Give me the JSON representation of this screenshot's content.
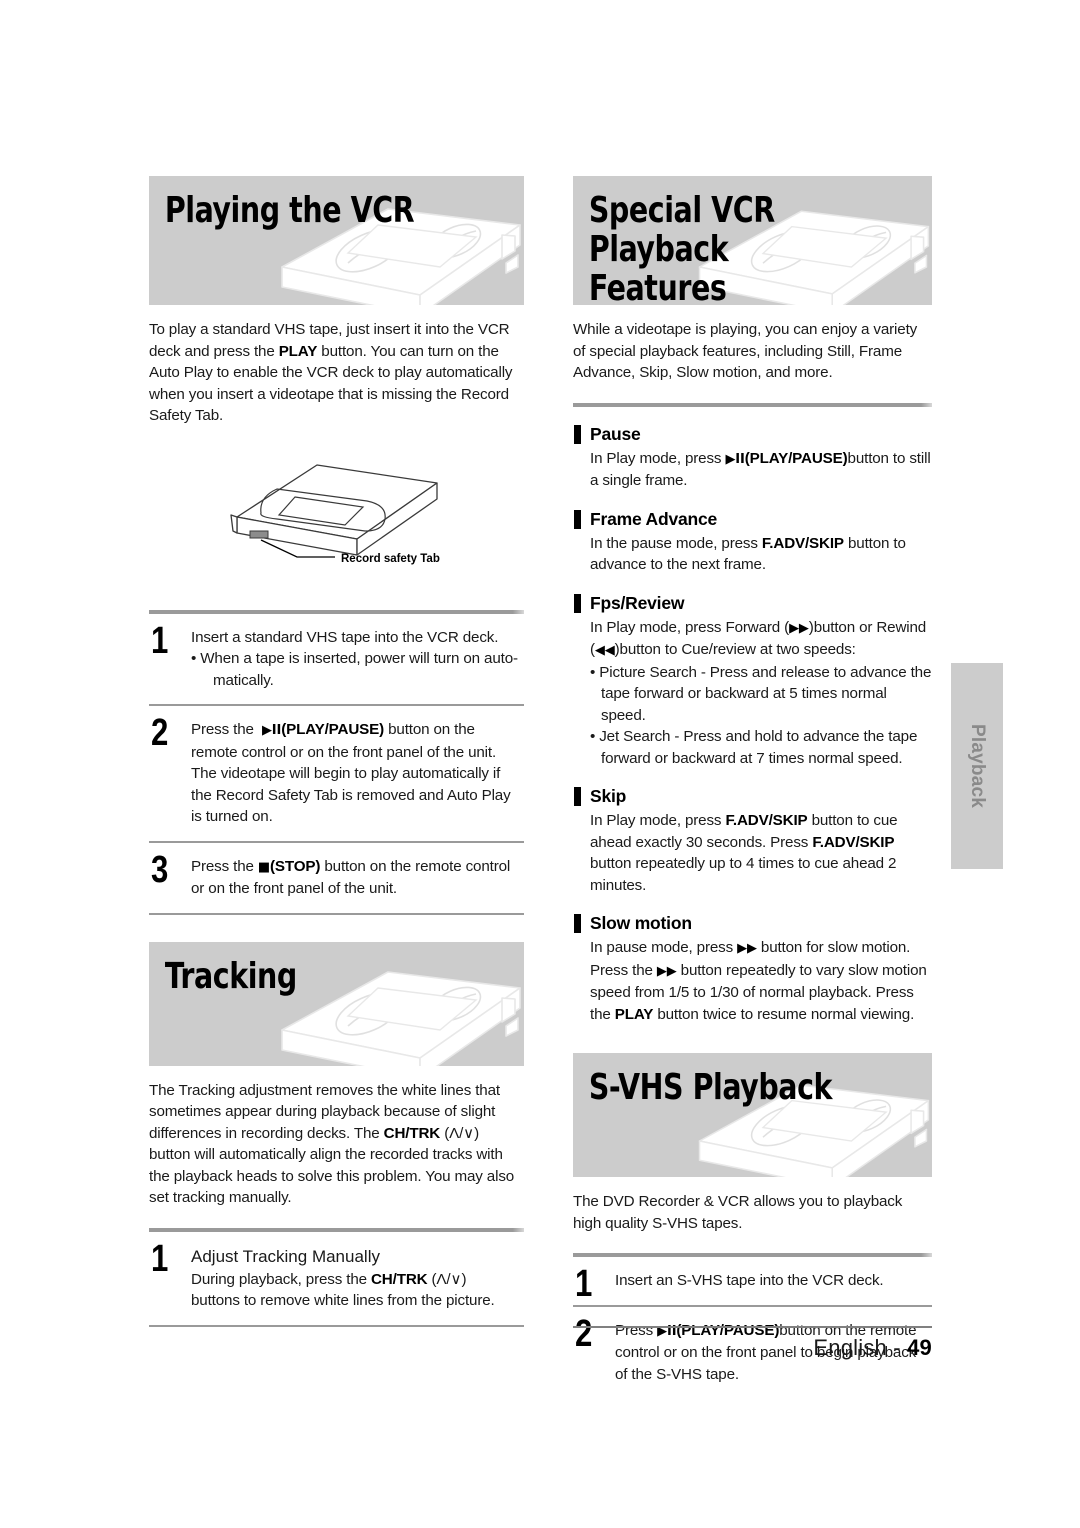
{
  "document": {
    "language_footer": "English - ",
    "page_number": "49",
    "side_tab_label": "Playback",
    "banner_bg": "#cccccc"
  },
  "left_column": {
    "section1": {
      "title": "Playing the VCR",
      "intro": "To play a standard VHS tape, just insert it into the VCR deck and press the PLAY button. You can turn on the Auto Play to enable the VCR deck to play automatically when you insert a videotape that is missing the Record Safety Tab.",
      "intro_bold_term": "PLAY",
      "figure_caption": "Record safety Tab",
      "steps": [
        {
          "number": "1",
          "line1": "Insert a standard VHS tape into the VCR deck.",
          "bullet": "• When a tape is inserted, power will turn on auto-matically."
        },
        {
          "number": "2",
          "text_before": "Press the ",
          "symbol": "▶II",
          "bold_term": "(PLAY/PAUSE)",
          "text_after": " button on the remote control or on the front panel of the unit. The videotape will begin to play automatically if the Record Safety Tab is removed and Auto Play is turned on."
        },
        {
          "number": "3",
          "text_before": "Press the ",
          "symbol": "■",
          "bold_term": "(STOP)",
          "text_after": " button on the remote control or on the front panel of the unit."
        }
      ]
    },
    "section2": {
      "title": "Tracking",
      "intro_part1": "The Tracking adjustment removes the white lines that sometimes appear during playback because of slight differences in recording decks. The ",
      "intro_bold": "CH/TRK",
      "intro_symbol": "(Λ/∨)",
      "intro_part2": " button will automatically align the recorded tracks with the playback heads to solve this problem. You may also set tracking manually.",
      "steps": [
        {
          "number": "1",
          "subtitle": "Adjust Tracking Manually",
          "text_before": "During playback, press the ",
          "bold_term": "CH/TRK",
          "symbol": "(Λ/∨)",
          "text_after": " buttons to remove white lines from the picture."
        }
      ]
    }
  },
  "right_column": {
    "section1": {
      "title": "Special VCR Playback\nFeatures",
      "intro": "While a videotape is playing, you can enjoy a variety of special playback features, including Still, Frame Advance, Skip, Slow motion, and more.",
      "features": [
        {
          "heading": "Pause",
          "text_before": "In Play mode, press ",
          "symbol": "▶II",
          "bold_term": "(PLAY/PAUSE)",
          "text_after": "button to still a single frame."
        },
        {
          "heading": "Frame Advance",
          "text_before": "In the pause mode, press ",
          "bold_term": "F.ADV/SKIP",
          "text_after": " button to advance to the next frame."
        },
        {
          "heading": "Fps/Review",
          "line1_a": "In Play mode, press Forward (",
          "line1_sym": "▶▶",
          "line1_b": ")button or Rewind (",
          "line2_sym": "◀◀",
          "line2_b": ")button to Cue/review at two speeds:",
          "bullets": [
            "• Picture Search - Press and release to advance the tape forward or backward at 5 times normal speed.",
            "• Jet Search - Press and hold to advance the tape forward or backward at 7 times normal speed."
          ]
        },
        {
          "heading": "Skip",
          "text_before": "In Play mode, press ",
          "bold_term": "F.ADV/SKIP",
          "text_mid": " button to cue ahead exactly 30 seconds. Press ",
          "bold_term2": "F.ADV/SKIP",
          "text_after": " button repeatedly up to 4 times to cue ahead 2 minutes."
        },
        {
          "heading": "Slow motion",
          "text_before": "In pause mode, press ",
          "symbol": "▶▶",
          "text_mid": " button for slow motion. Press the ",
          "symbol2": "▶▶",
          "text_mid2": " button repeatedly to vary slow motion speed from 1/5 to 1/30 of normal playback. Press the ",
          "bold_term": "PLAY",
          "text_after": " button twice to resume normal viewing."
        }
      ]
    },
    "section2": {
      "title": "S-VHS Playback",
      "intro": "The DVD Recorder & VCR allows you to playback high quality S-VHS tapes.",
      "steps": [
        {
          "number": "1",
          "text": "Insert an S-VHS tape into the VCR deck."
        },
        {
          "number": "2",
          "text_before": "Press ",
          "symbol": "▶II",
          "bold_term": "(PLAY/PAUSE)",
          "text_after": "button on the remote control or on the front panel to begin playback of the S-VHS tape."
        }
      ]
    }
  }
}
